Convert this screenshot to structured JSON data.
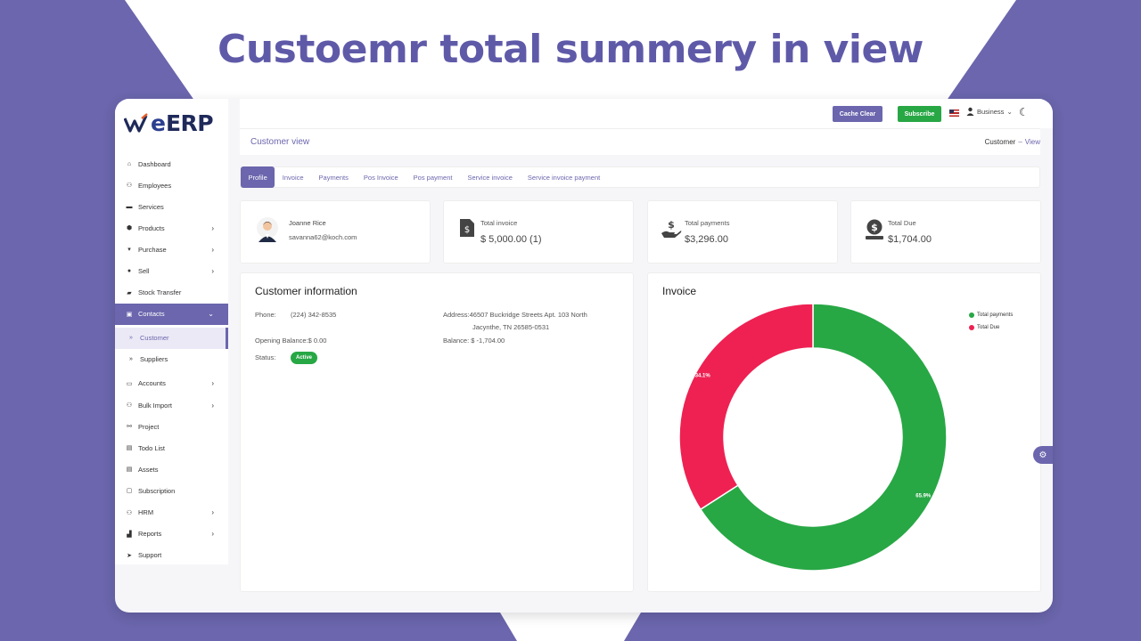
{
  "hero_title": "Custoemr total summery in view",
  "logo": {
    "we": "we",
    "erp": "ERP"
  },
  "topbar": {
    "cache_label": "Cache Clear",
    "subscribe_label": "Subscribe",
    "business_label": "Business"
  },
  "page": {
    "title": "Customer view",
    "breadcrumb_parent": "Customer",
    "breadcrumb_sep": "–",
    "breadcrumb_current": "View"
  },
  "sidebar": {
    "items": [
      {
        "label": "Dashboard",
        "icon": "home-icon",
        "glyph": "⌂"
      },
      {
        "label": "Employees",
        "icon": "users-icon",
        "glyph": "⚇"
      },
      {
        "label": "Services",
        "icon": "briefcase-icon",
        "glyph": "▬"
      },
      {
        "label": "Products",
        "icon": "box-icon",
        "glyph": "⬢"
      },
      {
        "label": "Purchase",
        "icon": "cart-icon",
        "glyph": "▾"
      },
      {
        "label": "Sell",
        "icon": "sell-icon",
        "glyph": "●"
      },
      {
        "label": "Stock Transfer",
        "icon": "truck-icon",
        "glyph": "▰"
      },
      {
        "label": "Contacts",
        "icon": "contacts-icon",
        "glyph": "▣"
      },
      {
        "label": "Customer",
        "icon": "chevron-right-icon",
        "glyph": "»"
      },
      {
        "label": "Suppliers",
        "icon": "chevron-right-icon",
        "glyph": "»"
      },
      {
        "label": "Accounts",
        "icon": "accounts-icon",
        "glyph": "▭"
      },
      {
        "label": "Bulk Import",
        "icon": "users-icon",
        "glyph": "⚇"
      },
      {
        "label": "Project",
        "icon": "project-icon",
        "glyph": "⚯"
      },
      {
        "label": "Todo List",
        "icon": "list-icon",
        "glyph": "▤"
      },
      {
        "label": "Assets",
        "icon": "assets-icon",
        "glyph": "▤"
      },
      {
        "label": "Subscription",
        "icon": "subscription-icon",
        "glyph": "▢"
      },
      {
        "label": "HRM",
        "icon": "users-icon",
        "glyph": "⚇"
      },
      {
        "label": "Reports",
        "icon": "chart-icon",
        "glyph": "▟"
      },
      {
        "label": "Support",
        "icon": "send-icon",
        "glyph": "➤"
      }
    ]
  },
  "tabs": [
    "Profile",
    "Invoice",
    "Payments",
    "Pos Invoice",
    "Pos payment",
    "Service invoice",
    "Service invoice payment"
  ],
  "customer": {
    "name": "Joanne Rice",
    "email": "savanna62@koch.com"
  },
  "stats": {
    "total_invoice": {
      "label": "Total invoice",
      "value": "$ 5,000.00 (1)"
    },
    "total_payments": {
      "label": "Total payments",
      "value": "$3,296.00"
    },
    "total_due": {
      "label": "Total Due",
      "value": "$1,704.00"
    }
  },
  "info": {
    "title": "Customer information",
    "phone_label": "Phone:",
    "phone": "(224) 342-8535",
    "address_line1": "Address:46507 Buckridge Streets Apt. 103 North",
    "address_line2": "Jacynthe, TN 26585-0531",
    "opening_balance": "Opening Balance:$ 0.00",
    "balance": "Balance:   $ -1,704.00",
    "status_label": "Status:",
    "status": "Active"
  },
  "invoice_chart": {
    "title": "Invoice",
    "colors": {
      "payments": "#28a745",
      "due": "#ee2152"
    }
  },
  "chart_data": {
    "type": "pie",
    "title": "Invoice",
    "categories": [
      "Total payments",
      "Total Due"
    ],
    "values": [
      65.9,
      34.1
    ],
    "labels": [
      "65.9%",
      "34.1%"
    ],
    "legend": "top-right",
    "donut": true
  }
}
